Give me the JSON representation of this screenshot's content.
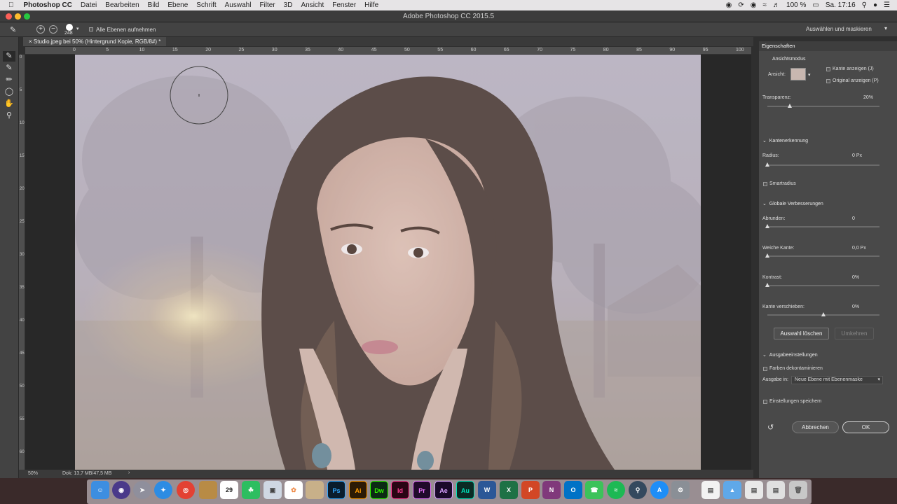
{
  "menubar": {
    "app": "Photoshop CC",
    "items": [
      "Datei",
      "Bearbeiten",
      "Bild",
      "Ebene",
      "Schrift",
      "Auswahl",
      "Filter",
      "3D",
      "Ansicht",
      "Fenster",
      "Hilfe"
    ],
    "battery": "100 %",
    "clock": "Sa. 17:16"
  },
  "window": {
    "title": "Adobe Photoshop CC 2015.5"
  },
  "options": {
    "brush_size": "248",
    "sample_all_label": "Alle Ebenen aufnehmen",
    "select_mask_label": "Auswählen und maskieren"
  },
  "document": {
    "tab": "Studio.jpeg bei 50% (Hintergrund Kopie, RGB/8#) *",
    "ruler_top": [
      "0",
      "5",
      "10",
      "15",
      "20",
      "25",
      "30",
      "35",
      "40",
      "45",
      "50",
      "55",
      "60",
      "65",
      "70",
      "75",
      "80",
      "85",
      "90",
      "95",
      "100"
    ],
    "ruler_left": [
      "0",
      "5",
      "10",
      "15",
      "20",
      "25",
      "30",
      "35",
      "40",
      "45",
      "50",
      "55",
      "60"
    ],
    "zoom": "50%",
    "doc_size": "Dok: 13,7 MB/47,5 MB"
  },
  "properties": {
    "title": "Eigenschaften",
    "view_mode": "Ansichtsmodus",
    "view_label": "Ansicht:",
    "show_edge": "Kante anzeigen (J)",
    "show_original": "Original anzeigen (P)",
    "transparency_label": "Transparenz:",
    "transparency_value": "20%",
    "transparency_level": 0.2,
    "edge_detection": "Kantenerkennung",
    "radius_label": "Radius:",
    "radius_value": "0 Px",
    "smart_radius": "Smartradius",
    "global_refinements": "Globale Verbesserungen",
    "smooth_label": "Abrunden:",
    "smooth_value": "0",
    "feather_label": "Weiche Kante:",
    "feather_value": "0,0 Px",
    "contrast_label": "Kontrast:",
    "contrast_value": "0%",
    "shift_edge_label": "Kante verschieben:",
    "shift_edge_value": "0%",
    "clear_selection": "Auswahl löschen",
    "invert": "Umkehren",
    "output_settings": "Ausgabeeinstellungen",
    "decontaminate": "Farben dekontaminieren",
    "output_to_label": "Ausgabe in:",
    "output_to_value": "Neue Ebene mit Ebenenmaske",
    "remember": "Einstellungen speichern",
    "cancel": "Abbrechen",
    "ok": "OK"
  },
  "dock": {
    "labels": [
      "Ps",
      "Ai",
      "Dw",
      "Id",
      "Pr",
      "Ae",
      "Au",
      "W",
      "X",
      "P",
      "N",
      "O"
    ],
    "calendar_day": "29"
  }
}
